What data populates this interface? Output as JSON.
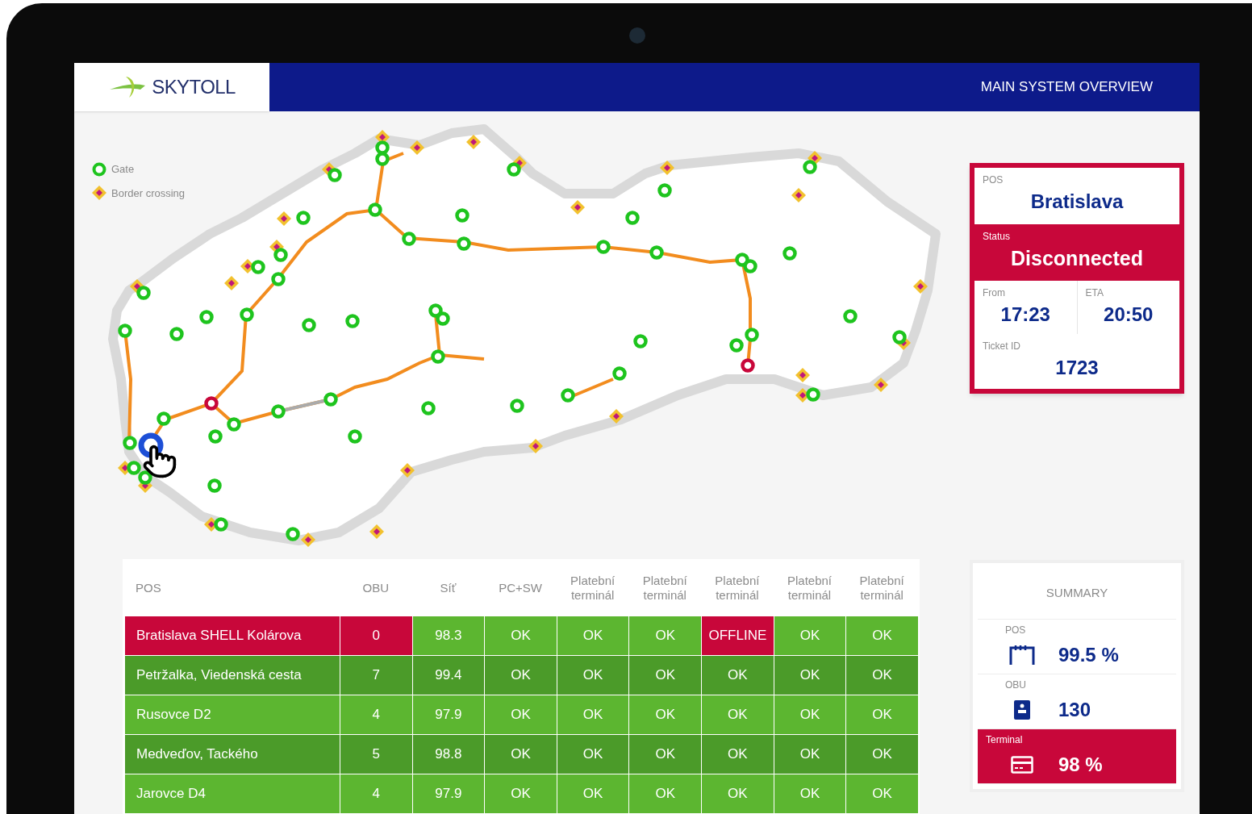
{
  "header": {
    "logo": "SKYTOLL",
    "title": "MAIN SYSTEM OVERVIEW"
  },
  "legend": [
    {
      "kind": "gate",
      "label": "Gate"
    },
    {
      "kind": "border",
      "label": "Border crossing"
    }
  ],
  "pos_card": {
    "pos_label": "POS",
    "pos_name": "Bratislava",
    "status_label": "Status",
    "status": "Disconnected",
    "alert": true,
    "from_label": "From",
    "from": "17:23",
    "eta_label": "ETA",
    "eta": "20:50",
    "ticket_label": "Ticket ID",
    "ticket": "1723"
  },
  "table": {
    "columns": [
      "POS",
      "OBU",
      "Síť",
      "PC+SW",
      "Platební terminál",
      "Platební terminál",
      "Platební terminál",
      "Platební terminál",
      "Platební terminál"
    ],
    "rows": [
      {
        "cells": [
          {
            "text": "Bratislava SHELL Kolárova",
            "alert": true
          },
          {
            "text": "0",
            "alert": true
          },
          {
            "text": "98.3",
            "alert": false
          },
          {
            "text": "OK",
            "alert": false
          },
          {
            "text": "OK",
            "alert": false
          },
          {
            "text": "OK",
            "alert": false
          },
          {
            "text": "OFFLINE",
            "alert": true
          },
          {
            "text": "OK",
            "alert": false
          },
          {
            "text": "OK",
            "alert": false
          }
        ]
      },
      {
        "cells": [
          {
            "text": "Petržalka, Viedenská cesta",
            "alert": false
          },
          {
            "text": "7",
            "alert": false
          },
          {
            "text": "99.4",
            "alert": false
          },
          {
            "text": "OK",
            "alert": false
          },
          {
            "text": "OK",
            "alert": false
          },
          {
            "text": "OK",
            "alert": false
          },
          {
            "text": "OK",
            "alert": false
          },
          {
            "text": "OK",
            "alert": false
          },
          {
            "text": "OK",
            "alert": false
          }
        ]
      },
      {
        "cells": [
          {
            "text": "Rusovce D2",
            "alert": false
          },
          {
            "text": "4",
            "alert": false
          },
          {
            "text": "97.9",
            "alert": false
          },
          {
            "text": "OK",
            "alert": false
          },
          {
            "text": "OK",
            "alert": false
          },
          {
            "text": "OK",
            "alert": false
          },
          {
            "text": "OK",
            "alert": false
          },
          {
            "text": "OK",
            "alert": false
          },
          {
            "text": "OK",
            "alert": false
          }
        ]
      },
      {
        "cells": [
          {
            "text": "Medveďov, Tackého",
            "alert": false
          },
          {
            "text": "5",
            "alert": false
          },
          {
            "text": "98.8",
            "alert": false
          },
          {
            "text": "OK",
            "alert": false
          },
          {
            "text": "OK",
            "alert": false
          },
          {
            "text": "OK",
            "alert": false
          },
          {
            "text": "OK",
            "alert": false
          },
          {
            "text": "OK",
            "alert": false
          },
          {
            "text": "OK",
            "alert": false
          }
        ]
      },
      {
        "cells": [
          {
            "text": "Jarovce D4",
            "alert": false
          },
          {
            "text": "4",
            "alert": false
          },
          {
            "text": "97.9",
            "alert": false
          },
          {
            "text": "OK",
            "alert": false
          },
          {
            "text": "OK",
            "alert": false
          },
          {
            "text": "OK",
            "alert": false
          },
          {
            "text": "OK",
            "alert": false
          },
          {
            "text": "OK",
            "alert": false
          },
          {
            "text": "OK",
            "alert": false
          }
        ]
      }
    ]
  },
  "summary": {
    "title": "SUMMARY",
    "items": [
      {
        "kind": "gantry",
        "label": "POS",
        "value": "99.5 %",
        "alert": false
      },
      {
        "kind": "obu",
        "label": "OBU",
        "value": "130",
        "alert": false
      },
      {
        "kind": "card",
        "label": "Terminal",
        "value": "98 %",
        "alert": true
      }
    ]
  }
}
